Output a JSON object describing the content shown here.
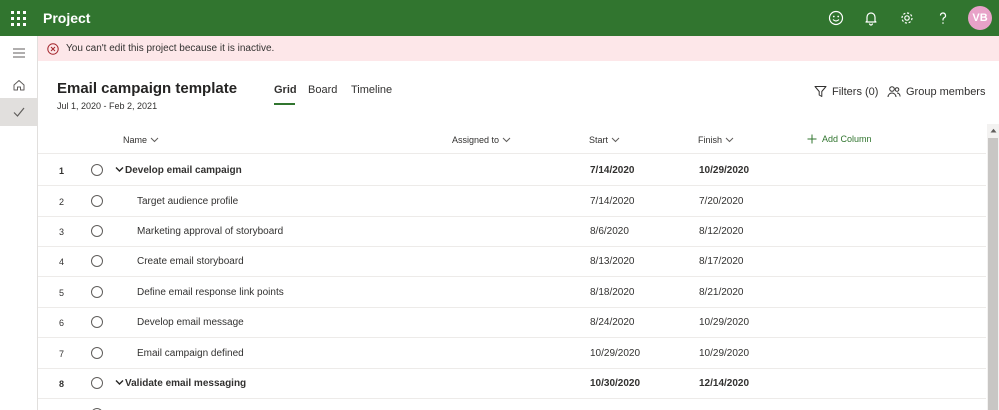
{
  "app": {
    "name": "Project",
    "user_initials": "VB",
    "brand_color": "#31752f",
    "top_icons": [
      "smiley-icon",
      "bell-icon",
      "gear-icon",
      "help-icon"
    ]
  },
  "banner": {
    "message": "You can't edit this project because it is inactive.",
    "color": "#fde7e9"
  },
  "project": {
    "title": "Email campaign template",
    "dates": "Jul 1, 2020 - Feb 2, 2021"
  },
  "tabs": [
    {
      "label": "Grid",
      "active": true
    },
    {
      "label": "Board",
      "active": false
    },
    {
      "label": "Timeline",
      "active": false
    }
  ],
  "actions": {
    "filters": "Filters (0)",
    "group_members": "Group members"
  },
  "columns": {
    "name": "Name",
    "assigned_to": "Assigned to",
    "start": "Start",
    "finish": "Finish",
    "add_column": "Add Column"
  },
  "rows": [
    {
      "num": "1",
      "name": "Develop email campaign",
      "start": "7/14/2020",
      "finish": "10/29/2020",
      "summary": true
    },
    {
      "num": "2",
      "name": "Target audience profile",
      "start": "7/14/2020",
      "finish": "7/20/2020",
      "summary": false
    },
    {
      "num": "3",
      "name": "Marketing approval of storyboard",
      "start": "8/6/2020",
      "finish": "8/12/2020",
      "summary": false
    },
    {
      "num": "4",
      "name": "Create email storyboard",
      "start": "8/13/2020",
      "finish": "8/17/2020",
      "summary": false
    },
    {
      "num": "5",
      "name": "Define email response link points",
      "start": "8/18/2020",
      "finish": "8/21/2020",
      "summary": false
    },
    {
      "num": "6",
      "name": "Develop email message",
      "start": "8/24/2020",
      "finish": "10/29/2020",
      "summary": false
    },
    {
      "num": "7",
      "name": "Email campaign defined",
      "start": "10/29/2020",
      "finish": "10/29/2020",
      "summary": false
    },
    {
      "num": "8",
      "name": "Validate email messaging",
      "start": "10/30/2020",
      "finish": "12/14/2020",
      "summary": true
    }
  ]
}
